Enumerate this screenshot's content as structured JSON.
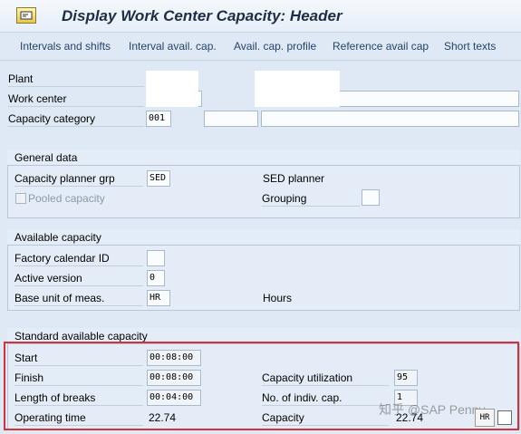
{
  "window": {
    "title": "Display Work Center Capacity: Header",
    "icon": "sap-transaction-icon"
  },
  "toolbar": {
    "items": [
      "Intervals and shifts",
      "Interval avail. cap.",
      "Avail. cap. profile",
      "Reference avail cap",
      "Short texts"
    ]
  },
  "header": {
    "plant_label": "Plant",
    "work_center_label": "Work center",
    "capacity_category_label": "Capacity category",
    "capacity_category_value": "001"
  },
  "general": {
    "title": "General data",
    "planner_grp_label": "Capacity planner grp",
    "planner_grp_value": "SED",
    "planner_grp_text": "SED planner",
    "pooled_label": "Pooled capacity",
    "grouping_label": "Grouping"
  },
  "available": {
    "title": "Available capacity",
    "factory_calendar_label": "Factory calendar ID",
    "active_version_label": "Active version",
    "active_version_value": "0",
    "base_unit_label": "Base unit of meas.",
    "base_unit_value": "HR",
    "base_unit_text": "Hours"
  },
  "standard": {
    "title": "Standard available capacity",
    "start_label": "Start",
    "start_value": "00:08:00",
    "finish_label": "Finish",
    "finish_value": "00:08:00",
    "breaks_label": "Length of breaks",
    "breaks_value": "00:04:00",
    "operating_label": "Operating time",
    "operating_value": "22.74",
    "utilization_label": "Capacity utilization",
    "utilization_value": "95",
    "indiv_label": "No. of indiv. cap.",
    "indiv_value": "1",
    "capacity_label": "Capacity",
    "capacity_value": "22.74"
  },
  "watermark": "知乎 @SAP Penny",
  "status_icon_text": "HR"
}
